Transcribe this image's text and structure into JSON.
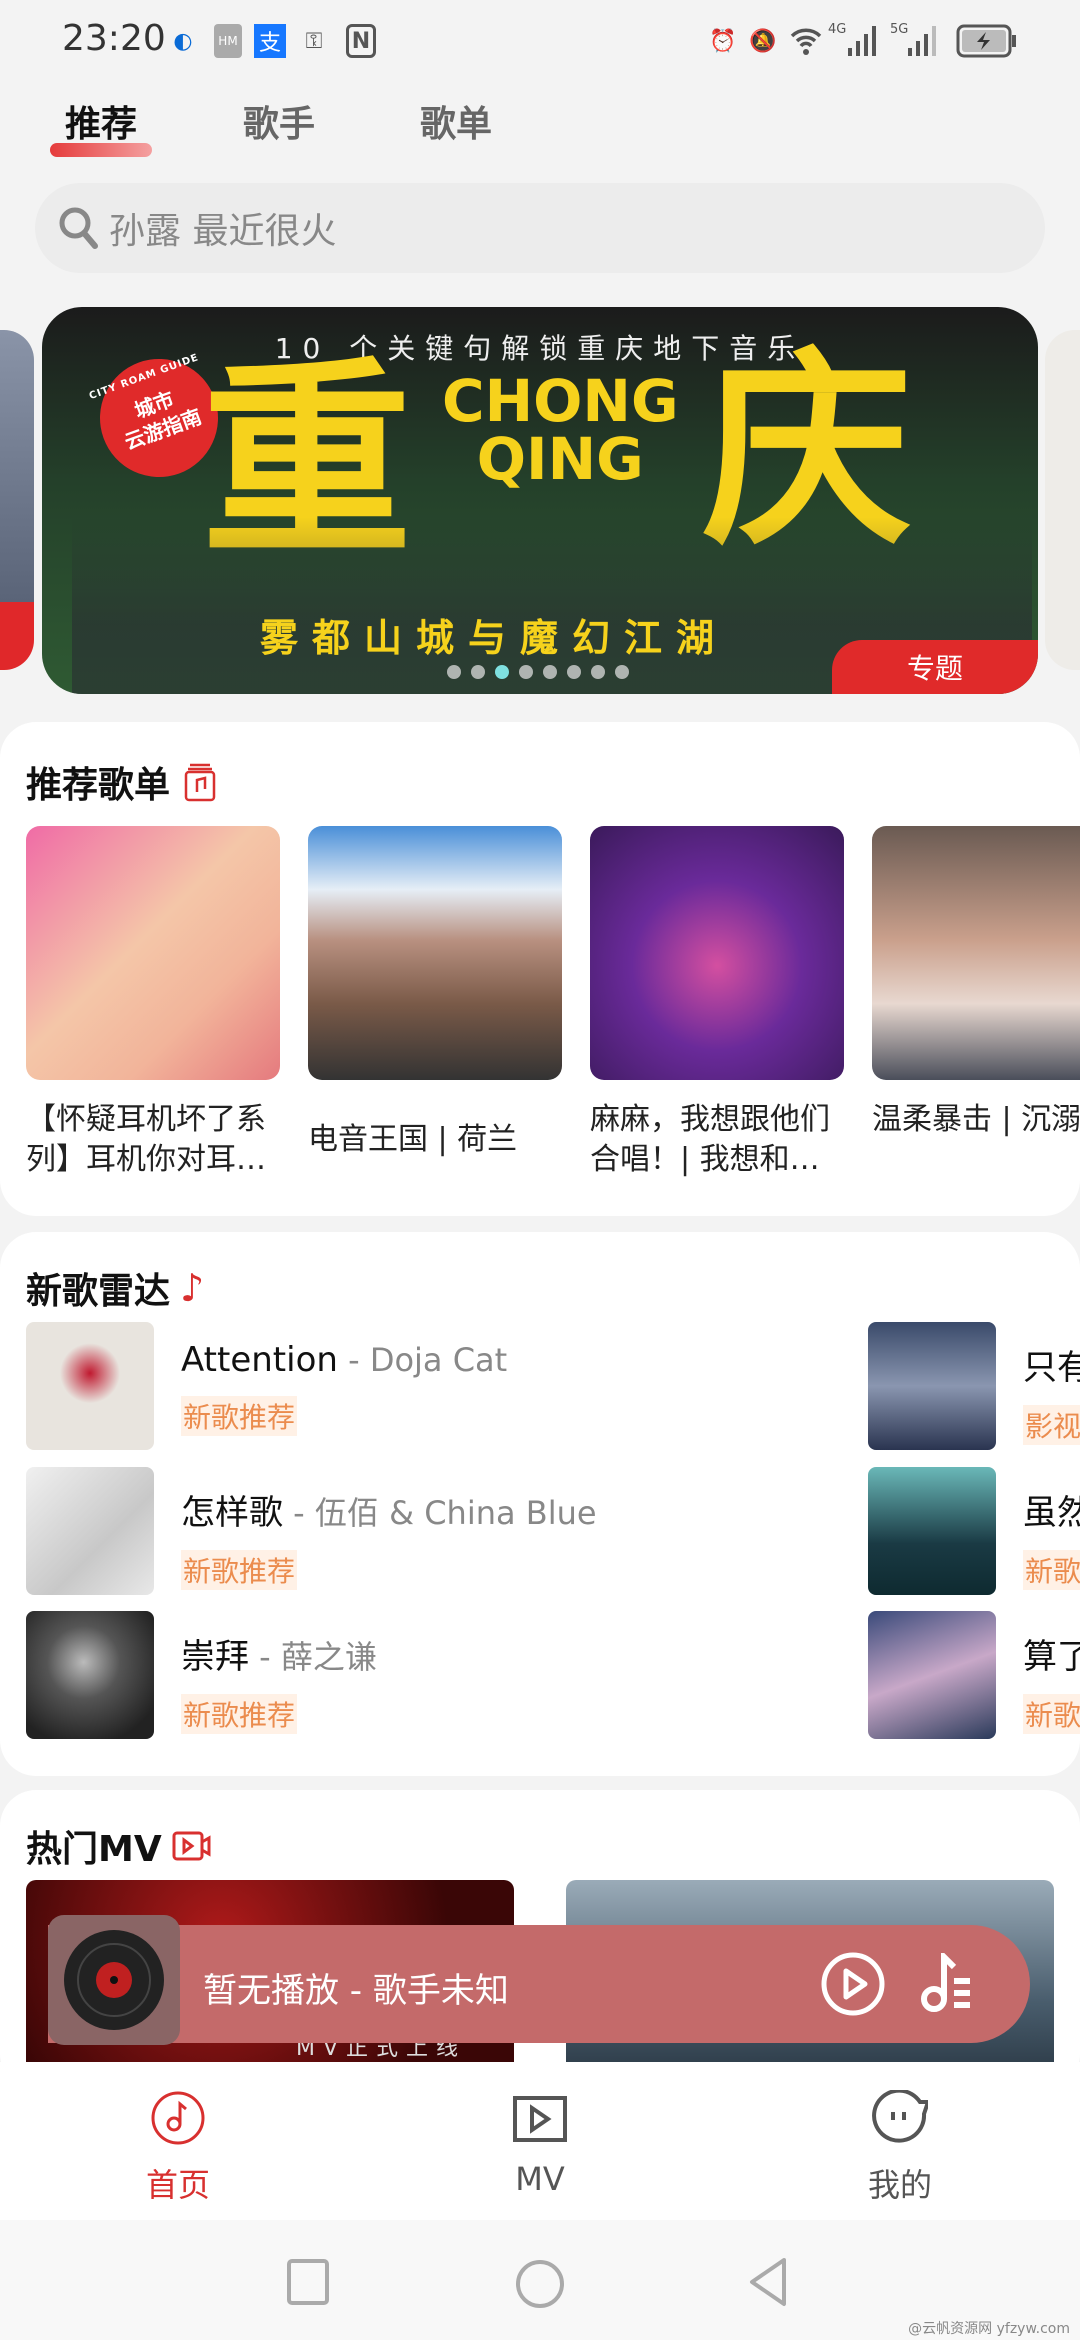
{
  "status_bar": {
    "time": "23:20",
    "network_4g": "4G",
    "network_5g": "5G",
    "left_icons": [
      "moon-icon",
      "hmos-icon",
      "alipay-icon",
      "key-icon",
      "nfc-icon"
    ],
    "right_icons": [
      "alarm-icon",
      "mute-icon",
      "wifi-icon",
      "signal-icon",
      "signal-icon",
      "battery-charging-icon"
    ]
  },
  "tabs": [
    {
      "label": "推荐",
      "active": true
    },
    {
      "label": "歌手"
    },
    {
      "label": "歌单"
    }
  ],
  "search": {
    "placeholder": "孙露 最近很火"
  },
  "banner": {
    "headline": "10 个关键句解锁重庆地下音乐",
    "big_left": "重",
    "big_right": "庆",
    "latin": "CHONG\nQING",
    "badge": "城市\n云游指南",
    "badge_ring": "CITY ROAM GUIDE",
    "subtitle": "雾都山城与魔幻江湖",
    "tag": "专题",
    "dots": 8,
    "active_dot": 3,
    "accent": "#e02a2a"
  },
  "playlists": {
    "title": "推荐歌单",
    "items": [
      {
        "name": "【怀疑耳机坏了系列】耳机你对耳…"
      },
      {
        "name": "电音王国 | 荷兰"
      },
      {
        "name": "麻麻，我想跟他们合唱！| 我想和…"
      },
      {
        "name": "温柔暴击 | 沉溺男友音的甜蜜乡"
      }
    ]
  },
  "new_songs": {
    "title": "新歌雷达",
    "left": [
      {
        "title": "Attention",
        "artist": "Doja Cat",
        "tag": "新歌推荐"
      },
      {
        "title": "怎样歌",
        "artist": "伍佰 & China Blue",
        "tag": "新歌推荐"
      },
      {
        "title": "崇拜",
        "artist": "薛之谦",
        "tag": "新歌推荐"
      }
    ],
    "right": [
      {
        "title": "只有",
        "tag": "影视"
      },
      {
        "title": "虽然",
        "tag": "新歌"
      },
      {
        "title": "算了",
        "tag": "新歌"
      }
    ],
    "tag_color": "#eb8c4e"
  },
  "mv": {
    "title": "热门MV",
    "thumb_caption": "MV正式上线"
  },
  "player": {
    "text": "暂无播放 - 歌手未知",
    "color": "#c46a6a"
  },
  "bottom_nav": [
    {
      "label": "首页",
      "active": true
    },
    {
      "label": "MV"
    },
    {
      "label": "我的"
    }
  ],
  "accent": "#d8302f",
  "watermark": "@云帆资源网 yfzyw.com"
}
